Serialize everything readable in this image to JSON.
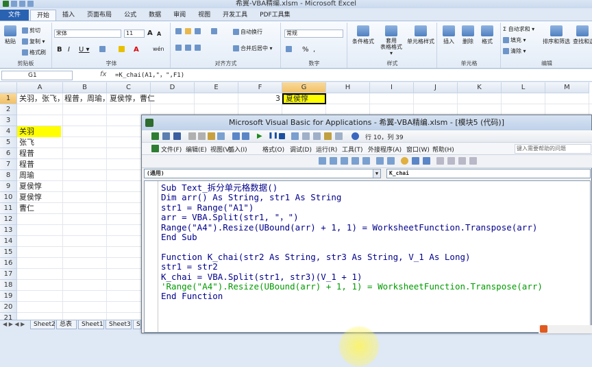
{
  "window": {
    "title": "希翼-VBA精编.xlsm - Microsoft Excel"
  },
  "ribbon": {
    "tabs": [
      "文件",
      "开始",
      "插入",
      "页面布局",
      "公式",
      "数据",
      "审阅",
      "视图",
      "开发工具",
      "PDF工具集"
    ],
    "groups": {
      "clipboard": "剪贴板",
      "font": "字体",
      "alignment": "对齐方式",
      "number": "数字",
      "styles": "样式",
      "cells": "单元格",
      "editing": "编辑"
    },
    "clipboard": {
      "paste": "粘贴",
      "cut": "剪切",
      "copy": "复制 ▾",
      "format_painter": "格式刷"
    },
    "font": {
      "name": "宋体",
      "size": "11",
      "bold": "B",
      "italic": "I",
      "underline": "U ▾",
      "grow": "A",
      "shrink": "A",
      "pinyin": "wén"
    },
    "alignment": {
      "wrap": "自动换行",
      "merge": "合并后居中 ▾"
    },
    "number": {
      "format": "常规",
      "pct": "%",
      "comma": ","
    },
    "styles": {
      "conditional": "条件格式",
      "table": "套用\n表格格式 ▾",
      "cell_styles": "单元格样式"
    },
    "cells": {
      "insert": "插入",
      "delete": "删除",
      "format": "格式"
    },
    "editing": {
      "autosum": "Σ 自动求和 ▾",
      "fill": "填充 ▾",
      "clear": "清除 ▾",
      "sort": "排序和筛选",
      "find": "查找和选"
    }
  },
  "formula_bar": {
    "name_box": "G1",
    "fx": "fx",
    "formula": "=K_chai(A1,\"，\",F1)"
  },
  "sheet": {
    "columns": [
      "A",
      "B",
      "C",
      "D",
      "E",
      "F",
      "G",
      "H",
      "I",
      "J",
      "K",
      "L",
      "M"
    ],
    "rows": [
      "1",
      "2",
      "3",
      "4",
      "5",
      "6",
      "7",
      "8",
      "9",
      "10",
      "11",
      "12",
      "13",
      "14",
      "15",
      "16",
      "17",
      "18",
      "19",
      "20",
      "21"
    ],
    "a1": "关羽，张飞，程普，周瑜，夏侯惇，曹仁",
    "f1": "3",
    "g1": "夏侯惇",
    "col_a": [
      "关羽",
      "张飞",
      "程普",
      "程普",
      "周瑜",
      "夏侯惇",
      "夏侯惇",
      "曹仁"
    ],
    "tabs": [
      "Sheet2",
      "总表",
      "Sheet1",
      "Sheet3",
      "S"
    ]
  },
  "vbe": {
    "title": "Microsoft Visual Basic for Applications - 希翼-VBA精编.xlsm - [模块5 (代码)]",
    "position": "行 10，列 39",
    "menu": [
      "文件(F)",
      "编辑(E)",
      "视图(V)",
      "插入(I)",
      "格式(O)",
      "调试(D)",
      "运行(R)",
      "工具(T)",
      "外接程序(A)",
      "窗口(W)",
      "帮助(H)"
    ],
    "help_placeholder": "键入需要帮助的问题",
    "object_combo": "(通用)",
    "proc_combo": "K_chai",
    "code": [
      {
        "text": "Sub Text_拆分单元格数据()",
        "comment": false
      },
      {
        "text": "Dim arr() As String, str1 As String",
        "comment": false
      },
      {
        "text": "str1 = Range(\"A1\")",
        "comment": false
      },
      {
        "text": "arr = VBA.Split(str1, \"，\")",
        "comment": false
      },
      {
        "text": "Range(\"A4\").Resize(UBound(arr) + 1, 1) = WorksheetFunction.Transpose(arr)",
        "comment": false
      },
      {
        "text": "End Sub",
        "comment": false
      },
      {
        "text": "",
        "comment": false
      },
      {
        "text": "Function K_chai(str2 As String, str3 As String, V_1 As Long)",
        "comment": false
      },
      {
        "text": "str1 = str2",
        "comment": false
      },
      {
        "text": "K_chai = VBA.Split(str1, str3)(V_1 + 1)",
        "comment": false
      },
      {
        "text": "'Range(\"A4\").Resize(UBound(arr) + 1, 1) = WorksheetFunction.Transpose(arr)",
        "comment": true
      },
      {
        "text": "End Function",
        "comment": false
      }
    ]
  },
  "colors": {
    "accent": "#2a62b2",
    "selection": "#ffff00",
    "comment": "#009a00",
    "keyword": "#00008b"
  }
}
